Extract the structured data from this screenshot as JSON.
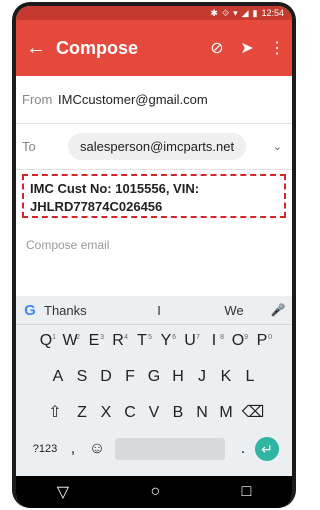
{
  "status_bar": {
    "time": "12:54"
  },
  "app_bar": {
    "title": "Compose",
    "back_icon": "arrow-left-icon",
    "attach_icon": "paperclip-icon",
    "send_icon": "send-icon",
    "menu_icon": "more-vert-icon"
  },
  "from": {
    "label": "From",
    "value": "IMCcustomer@gmail.com"
  },
  "to": {
    "label": "To",
    "recipient": "salesperson@imcparts.net"
  },
  "subject": {
    "line1": "IMC Cust No: 1015556, VIN:",
    "line2": "JHLRD77874C026456"
  },
  "body": {
    "placeholder": "Compose email"
  },
  "keyboard": {
    "suggestions": [
      "Thanks",
      "I",
      "We"
    ],
    "row1": [
      "Q",
      "W",
      "E",
      "R",
      "T",
      "Y",
      "U",
      "I",
      "O",
      "P"
    ],
    "row1_digits": [
      "1",
      "2",
      "3",
      "4",
      "5",
      "6",
      "7",
      "8",
      "9",
      "0"
    ],
    "row2": [
      "A",
      "S",
      "D",
      "F",
      "G",
      "H",
      "J",
      "K",
      "L"
    ],
    "row3": [
      "Z",
      "X",
      "C",
      "V",
      "B",
      "N",
      "M"
    ],
    "row4": {
      "symbols": "?123",
      "comma": ",",
      "period": "."
    }
  }
}
